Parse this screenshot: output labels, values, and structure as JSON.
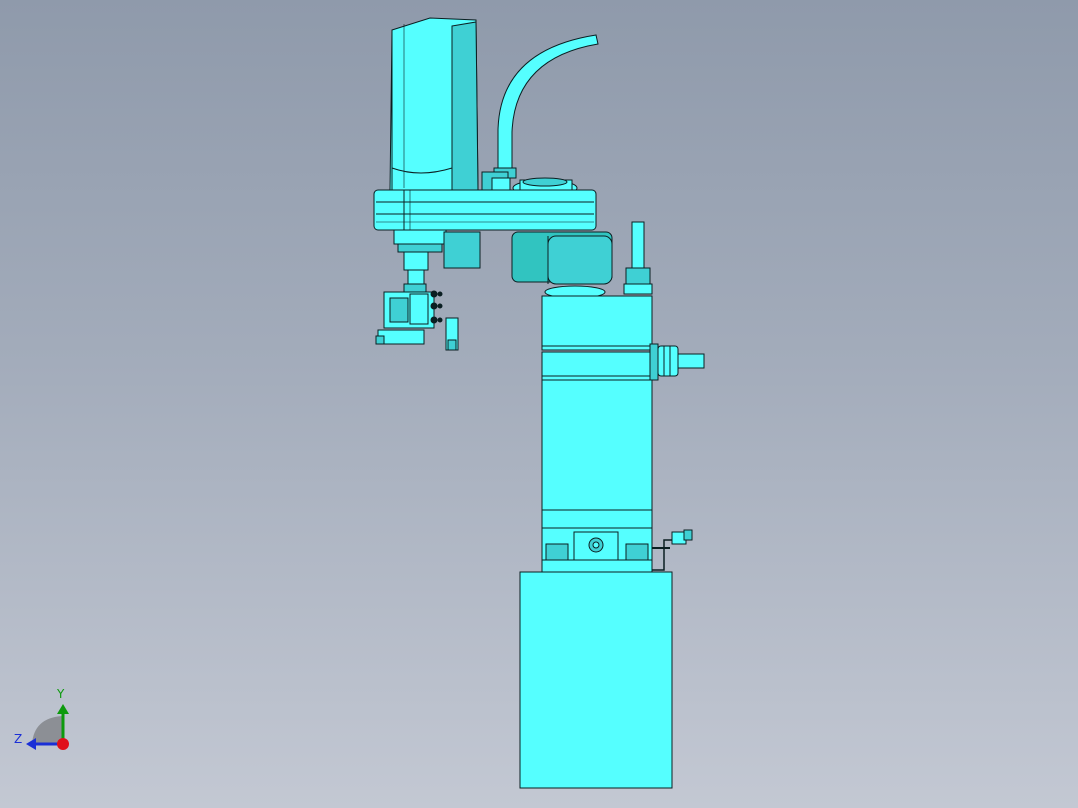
{
  "viewport": {
    "background_top": "#8f9aab",
    "background_bottom": "#c3c8d3",
    "model_fill": "#55ffff",
    "model_shade": "#3fd0d4",
    "model_edge": "#0b1f22"
  },
  "triad": {
    "y_label": "Y",
    "z_label": "Z",
    "y_color": "#0d9a0d",
    "z_color": "#1b2fd6",
    "origin_color": "#e0101a"
  }
}
